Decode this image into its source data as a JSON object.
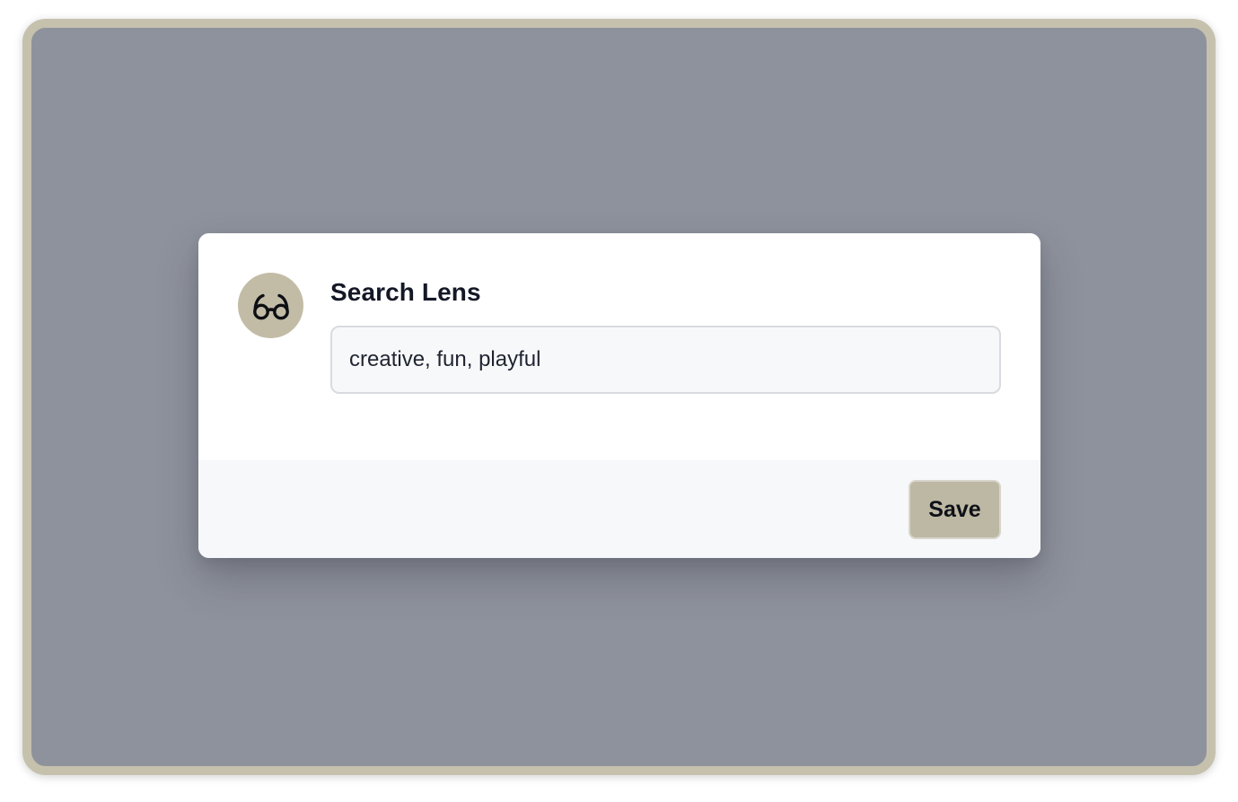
{
  "dialog": {
    "icon": "eyeglasses-icon",
    "title": "Search Lens",
    "input_value": "creative, fun, playful",
    "save_label": "Save"
  },
  "colors": {
    "frame_border": "#c5c1ad",
    "backdrop": "#8e929c",
    "icon_circle": "#c2bca6",
    "save_button": "#bdb8a3"
  }
}
